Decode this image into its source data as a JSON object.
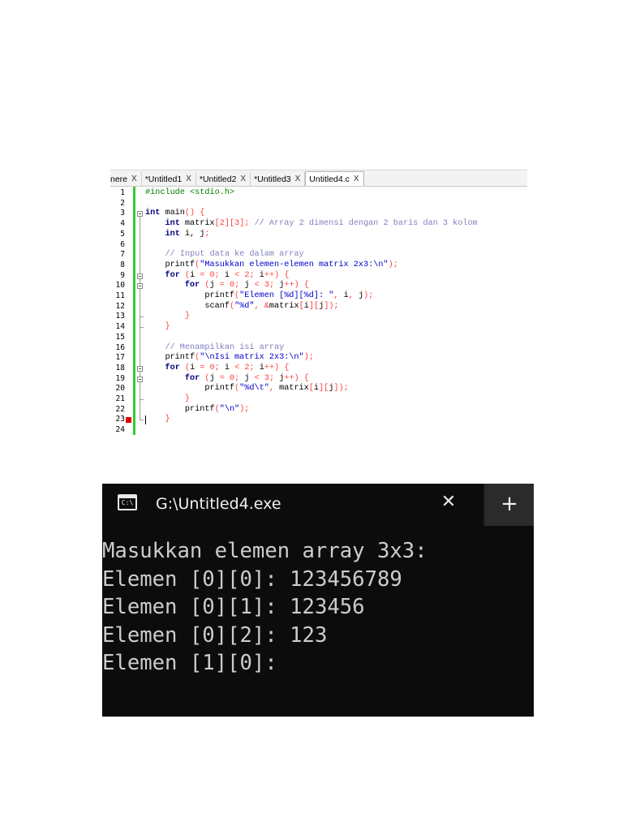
{
  "editor": {
    "tabs": [
      {
        "label": "nere",
        "close": "X"
      },
      {
        "label": "*Untitled1",
        "close": "X"
      },
      {
        "label": "*Untitled2",
        "close": "X"
      },
      {
        "label": "*Untitled3",
        "close": "X"
      },
      {
        "label": "Untitled4.c",
        "close": "X"
      }
    ],
    "active_tab": "Untitled4.c",
    "gutter_color": "#33cc33",
    "breakpoint_line": 23,
    "lines": [
      [
        {
          "t": "pp",
          "v": "#include <stdio.h>"
        }
      ],
      [],
      [
        {
          "t": "kw",
          "v": "int"
        },
        {
          "t": "",
          "v": " main"
        },
        {
          "t": "op",
          "v": "() {"
        }
      ],
      [
        {
          "t": "",
          "v": "    "
        },
        {
          "t": "kw",
          "v": "int"
        },
        {
          "t": "",
          "v": " matrix"
        },
        {
          "t": "op",
          "v": "["
        },
        {
          "t": "num",
          "v": "2"
        },
        {
          "t": "op",
          "v": "]["
        },
        {
          "t": "num",
          "v": "3"
        },
        {
          "t": "op",
          "v": "];"
        },
        {
          "t": "cmt",
          "v": " // Array 2 dimensi dengan 2 baris dan 3 kolom"
        }
      ],
      [
        {
          "t": "",
          "v": "    "
        },
        {
          "t": "kw",
          "v": "int"
        },
        {
          "t": "",
          "v": " i, j"
        },
        {
          "t": "op",
          "v": ";"
        }
      ],
      [],
      [
        {
          "t": "",
          "v": "    "
        },
        {
          "t": "cmt",
          "v": "// Input data ke dalam array"
        }
      ],
      [
        {
          "t": "",
          "v": "    printf"
        },
        {
          "t": "op",
          "v": "("
        },
        {
          "t": "str",
          "v": "\"Masukkan elemen-elemen matrix 2x3:\\n\""
        },
        {
          "t": "op",
          "v": ");"
        }
      ],
      [
        {
          "t": "",
          "v": "    "
        },
        {
          "t": "kw",
          "v": "for"
        },
        {
          "t": "",
          "v": " "
        },
        {
          "t": "op",
          "v": "("
        },
        {
          "t": "",
          "v": "i "
        },
        {
          "t": "op",
          "v": "="
        },
        {
          "t": "",
          "v": " "
        },
        {
          "t": "num",
          "v": "0"
        },
        {
          "t": "op",
          "v": ";"
        },
        {
          "t": "",
          "v": " i "
        },
        {
          "t": "op",
          "v": "<"
        },
        {
          "t": "",
          "v": " "
        },
        {
          "t": "num",
          "v": "2"
        },
        {
          "t": "op",
          "v": ";"
        },
        {
          "t": "",
          "v": " i"
        },
        {
          "t": "op",
          "v": "++) {"
        }
      ],
      [
        {
          "t": "",
          "v": "        "
        },
        {
          "t": "kw",
          "v": "for"
        },
        {
          "t": "",
          "v": " "
        },
        {
          "t": "op",
          "v": "("
        },
        {
          "t": "",
          "v": "j "
        },
        {
          "t": "op",
          "v": "="
        },
        {
          "t": "",
          "v": " "
        },
        {
          "t": "num",
          "v": "0"
        },
        {
          "t": "op",
          "v": ";"
        },
        {
          "t": "",
          "v": " j "
        },
        {
          "t": "op",
          "v": "<"
        },
        {
          "t": "",
          "v": " "
        },
        {
          "t": "num",
          "v": "3"
        },
        {
          "t": "op",
          "v": ";"
        },
        {
          "t": "",
          "v": " j"
        },
        {
          "t": "op",
          "v": "++) {"
        }
      ],
      [
        {
          "t": "",
          "v": "            printf"
        },
        {
          "t": "op",
          "v": "("
        },
        {
          "t": "str",
          "v": "\"Elemen [%d][%d]: \""
        },
        {
          "t": "op",
          "v": ","
        },
        {
          "t": "",
          "v": " i"
        },
        {
          "t": "op",
          "v": ","
        },
        {
          "t": "",
          "v": " j"
        },
        {
          "t": "op",
          "v": ");"
        }
      ],
      [
        {
          "t": "",
          "v": "            scanf"
        },
        {
          "t": "op",
          "v": "("
        },
        {
          "t": "str",
          "v": "\"%d\""
        },
        {
          "t": "op",
          "v": ","
        },
        {
          "t": "",
          "v": " "
        },
        {
          "t": "op",
          "v": "&"
        },
        {
          "t": "",
          "v": "matrix"
        },
        {
          "t": "op",
          "v": "["
        },
        {
          "t": "",
          "v": "i"
        },
        {
          "t": "op",
          "v": "]["
        },
        {
          "t": "",
          "v": "j"
        },
        {
          "t": "op",
          "v": "]);"
        }
      ],
      [
        {
          "t": "",
          "v": "        "
        },
        {
          "t": "op",
          "v": "}"
        }
      ],
      [
        {
          "t": "",
          "v": "    "
        },
        {
          "t": "op",
          "v": "}"
        }
      ],
      [],
      [
        {
          "t": "",
          "v": "    "
        },
        {
          "t": "cmt",
          "v": "// Menampilkan isi array"
        }
      ],
      [
        {
          "t": "",
          "v": "    printf"
        },
        {
          "t": "op",
          "v": "("
        },
        {
          "t": "str",
          "v": "\"\\nIsi matrix 2x3:\\n\""
        },
        {
          "t": "op",
          "v": ");"
        }
      ],
      [
        {
          "t": "",
          "v": "    "
        },
        {
          "t": "kw",
          "v": "for"
        },
        {
          "t": "",
          "v": " "
        },
        {
          "t": "op",
          "v": "("
        },
        {
          "t": "",
          "v": "i "
        },
        {
          "t": "op",
          "v": "="
        },
        {
          "t": "",
          "v": " "
        },
        {
          "t": "num",
          "v": "0"
        },
        {
          "t": "op",
          "v": ";"
        },
        {
          "t": "",
          "v": " i "
        },
        {
          "t": "op",
          "v": "<"
        },
        {
          "t": "",
          "v": " "
        },
        {
          "t": "num",
          "v": "2"
        },
        {
          "t": "op",
          "v": ";"
        },
        {
          "t": "",
          "v": " i"
        },
        {
          "t": "op",
          "v": "++) {"
        }
      ],
      [
        {
          "t": "",
          "v": "        "
        },
        {
          "t": "kw",
          "v": "for"
        },
        {
          "t": "",
          "v": " "
        },
        {
          "t": "op",
          "v": "("
        },
        {
          "t": "",
          "v": "j "
        },
        {
          "t": "op",
          "v": "="
        },
        {
          "t": "",
          "v": " "
        },
        {
          "t": "num",
          "v": "0"
        },
        {
          "t": "op",
          "v": ";"
        },
        {
          "t": "",
          "v": " j "
        },
        {
          "t": "op",
          "v": "<"
        },
        {
          "t": "",
          "v": " "
        },
        {
          "t": "num",
          "v": "3"
        },
        {
          "t": "op",
          "v": ";"
        },
        {
          "t": "",
          "v": " j"
        },
        {
          "t": "op",
          "v": "++) {"
        }
      ],
      [
        {
          "t": "",
          "v": "            printf"
        },
        {
          "t": "op",
          "v": "("
        },
        {
          "t": "str",
          "v": "\"%d\\t\""
        },
        {
          "t": "op",
          "v": ","
        },
        {
          "t": "",
          "v": " matrix"
        },
        {
          "t": "op",
          "v": "["
        },
        {
          "t": "",
          "v": "i"
        },
        {
          "t": "op",
          "v": "]["
        },
        {
          "t": "",
          "v": "j"
        },
        {
          "t": "op",
          "v": "]);"
        }
      ],
      [
        {
          "t": "",
          "v": "        "
        },
        {
          "t": "op",
          "v": "}"
        }
      ],
      [
        {
          "t": "",
          "v": "        printf"
        },
        {
          "t": "op",
          "v": "("
        },
        {
          "t": "str",
          "v": "\"\\n\""
        },
        {
          "t": "op",
          "v": ");"
        }
      ],
      [
        {
          "t": "",
          "v": "    "
        },
        {
          "t": "op",
          "v": "}"
        }
      ],
      []
    ]
  },
  "terminal": {
    "icon": "cmd-icon",
    "icon_text": "C:\\",
    "title": "G:\\Untitled4.exe",
    "close_glyph": "✕",
    "new_tab_glyph": "+",
    "output": [
      "Masukkan elemen array 3x3:",
      "Elemen [0][0]: 123456789",
      "Elemen [0][1]: 123456",
      "Elemen [0][2]: 123",
      "Elemen [1][0]:"
    ]
  }
}
